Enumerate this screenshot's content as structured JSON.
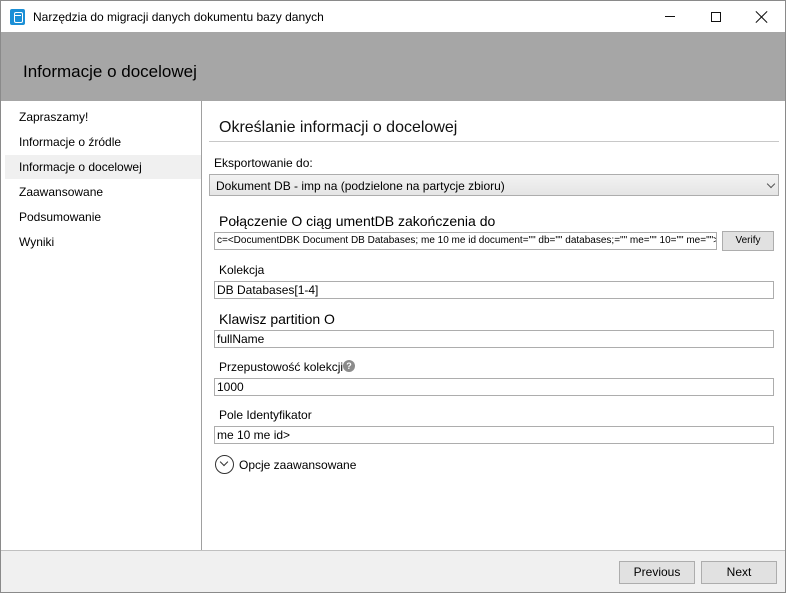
{
  "window": {
    "title": "Narzędzia do migracji danych dokumentu bazy danych",
    "minimize_label": "",
    "maximize_label": "",
    "close_label": ""
  },
  "header": {
    "title": "Informacje o docelowej"
  },
  "sidebar": {
    "items": [
      {
        "label": "Zapraszamy!",
        "selected": false
      },
      {
        "label": "Informacje o źródle",
        "selected": false
      },
      {
        "label": "Informacje o docelowej",
        "selected": true
      },
      {
        "label": "Zaawansowane",
        "selected": false
      },
      {
        "label": "Podsumowanie",
        "selected": false
      },
      {
        "label": "Wyniki",
        "selected": false
      }
    ]
  },
  "main": {
    "section_title": "Określanie informacji o docelowej",
    "export_label": "Eksportowanie do:",
    "export_value": "Dokument DB - imp na (podzielone na partycje zbioru)",
    "connection_label": "Połączenie O ciąg umentDB zakończenia do",
    "connection_value": "c=<DocumentDBK Document DB Databases; me 10 me id document=\"\" db=\"\" databases;=\"\" me=\"\" 10=\"\" me=\"\">‹/DocumentDBK Document",
    "verify_label": "Verify",
    "collection_label": "Kolekcja",
    "collection_value": "DB Databases[1-4]",
    "partition_label": "Klawisz partition O",
    "partition_value": "fullName",
    "throughput_label": "Przepustowość kolekcji",
    "throughput_value": "1000",
    "id_label": "Pole Identyfikator",
    "id_value": "me 10 me id>",
    "advanced_label": "Opcje zaawansowane"
  },
  "footer": {
    "previous_label": "Previous",
    "next_label": "Next"
  },
  "icons": {
    "app": "database-migration-icon",
    "help": "question-circle-icon",
    "expand": "chevron-down-circle-icon"
  },
  "colors": {
    "header_band": "#a6a6a6",
    "selected_item": "#f0f0f0",
    "footer_bg": "#f0f0f0",
    "app_icon": "#1b8fd6"
  }
}
